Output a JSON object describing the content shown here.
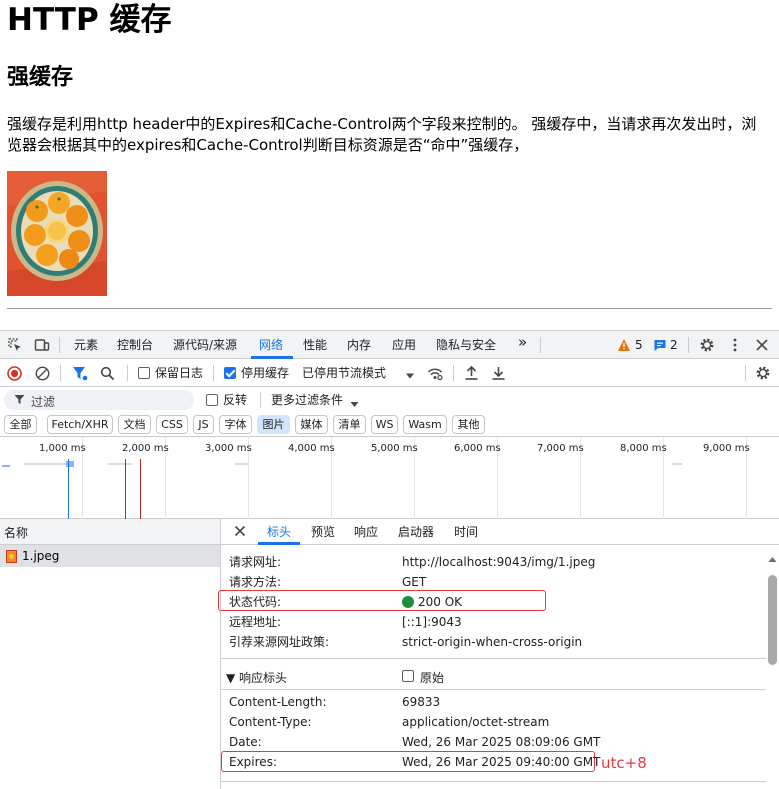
{
  "page": {
    "title": "HTTP 缓存",
    "subtitle": "强缓存",
    "paragraph": "强缓存是利用http header中的Expires和Cache-Control两个字段来控制的。 强缓存中，当请求再次发出时，浏览器会根据其中的expires和Cache-Control判断目标资源是否“命中”强缓存，"
  },
  "devtools": {
    "tabs": [
      "元素",
      "控制台",
      "源代码/来源",
      "网络",
      "性能",
      "内存",
      "应用",
      "隐私与安全"
    ],
    "active_tab": "网络",
    "more_tabs": "»",
    "warnings_count": "5",
    "messages_count": "2",
    "toolbar": {
      "preserve_log": "保留日志",
      "disable_cache": "停用缓存",
      "throttling": "已停用节流模式"
    },
    "filter": {
      "placeholder": "过滤",
      "invert": "反转",
      "more_filters": "更多过滤条件"
    },
    "type_filters": [
      "全部",
      "Fetch/XHR",
      "文档",
      "CSS",
      "JS",
      "字体",
      "图片",
      "媒体",
      "清单",
      "WS",
      "Wasm",
      "其他"
    ],
    "active_type_filter": "图片",
    "timeline_ticks": [
      "1,000 ms",
      "2,000 ms",
      "3,000 ms",
      "4,000 ms",
      "5,000 ms",
      "6,000 ms",
      "7,000 ms",
      "8,000 ms",
      "9,000 ms"
    ],
    "name_column": "名称",
    "requests": [
      {
        "name": "1.jpeg"
      }
    ],
    "detail_tabs": [
      "标头",
      "预览",
      "响应",
      "启动器",
      "时间"
    ],
    "active_detail_tab": "标头",
    "general": [
      {
        "key": "请求网址:",
        "value": "http://localhost:9043/img/1.jpeg"
      },
      {
        "key": "请求方法:",
        "value": "GET"
      },
      {
        "key": "状态代码:",
        "value": "200 OK"
      },
      {
        "key": "远程地址:",
        "value": "[::1]:9043"
      },
      {
        "key": "引荐来源网址政策:",
        "value": "strict-origin-when-cross-origin"
      }
    ],
    "response_headers_title": "▼ 响应标头",
    "raw_label": "原始",
    "response_headers": [
      {
        "key": "Content-Length:",
        "value": "69833"
      },
      {
        "key": "Content-Type:",
        "value": "application/octet-stream"
      },
      {
        "key": "Date:",
        "value": "Wed, 26 Mar 2025 08:09:06 GMT"
      },
      {
        "key": "Expires:",
        "value": "Wed, 26 Mar 2025 09:40:00 GMT"
      }
    ],
    "annotation": "utc+8"
  },
  "colors": {
    "accent": "#1a73e8",
    "annotation_red": "#e5393e",
    "status_green": "#1e8e3e",
    "warning_orange": "#e8710a"
  }
}
